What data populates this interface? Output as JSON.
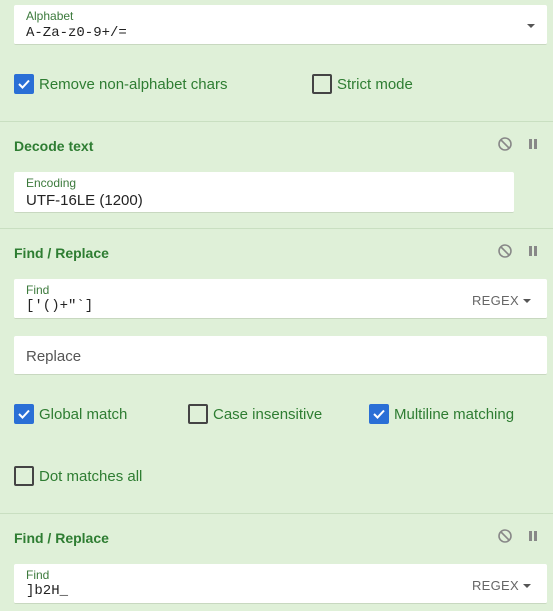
{
  "alphabet": {
    "label": "Alphabet",
    "value": "A-Za-z0-9+/="
  },
  "remove_non_alpha": {
    "label": "Remove non-alphabet chars",
    "checked": true
  },
  "strict_mode": {
    "label": "Strict mode",
    "checked": false
  },
  "decode_text": {
    "title": "Decode text",
    "encoding_label": "Encoding",
    "encoding_value": "UTF-16LE (1200)"
  },
  "find_replace_1": {
    "title": "Find / Replace",
    "find_label": "Find",
    "find_value": "['()+\"`]",
    "mode": "REGEX",
    "replace_placeholder": "Replace",
    "global_match": {
      "label": "Global match",
      "checked": true
    },
    "case_insensitive": {
      "label": "Case insensitive",
      "checked": false
    },
    "multiline": {
      "label": "Multiline matching",
      "checked": true
    },
    "dot_all": {
      "label": "Dot matches all",
      "checked": false
    }
  },
  "find_replace_2": {
    "title": "Find / Replace",
    "find_label": "Find",
    "find_value": "]b2H_",
    "mode": "REGEX"
  },
  "icons": {
    "disable": "disable-icon",
    "pause": "pause-icon"
  },
  "colors": {
    "background": "#dff0d8",
    "accent": "#2e7d32",
    "checkbox": "#2a6fd6"
  }
}
